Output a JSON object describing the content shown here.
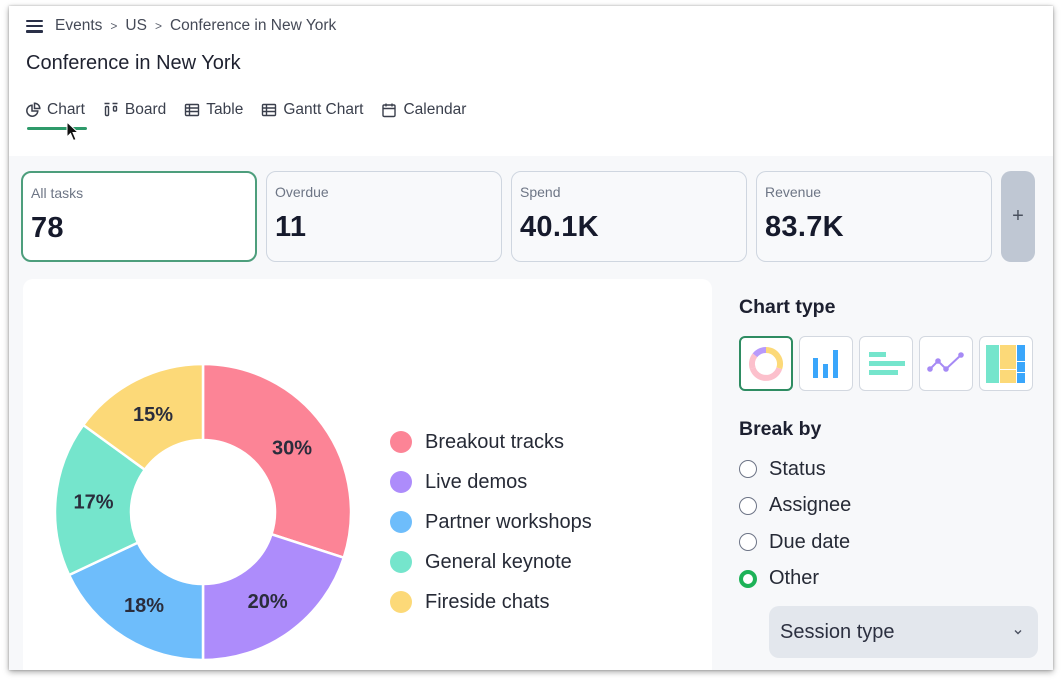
{
  "breadcrumb": {
    "items": [
      "Events",
      "US",
      "Conference in New York"
    ],
    "separator": ">"
  },
  "page": {
    "title": "Conference in New York"
  },
  "tabs": [
    {
      "label": "Chart",
      "icon": "chart-pie-icon",
      "active": true
    },
    {
      "label": "Board",
      "icon": "board-icon",
      "active": false
    },
    {
      "label": "Table",
      "icon": "table-icon",
      "active": false
    },
    {
      "label": "Gantt Chart",
      "icon": "gantt-icon",
      "active": false
    },
    {
      "label": "Calendar",
      "icon": "calendar-icon",
      "active": false
    }
  ],
  "metrics": [
    {
      "label": "All tasks",
      "value": "78",
      "active": true
    },
    {
      "label": "Overdue",
      "value": "11",
      "active": false
    },
    {
      "label": "Spend",
      "value": "40.1K",
      "active": false
    },
    {
      "label": "Revenue",
      "value": "83.7K",
      "active": false
    }
  ],
  "add_metric_label": "+",
  "side_panel": {
    "chart_type_title": "Chart type",
    "chart_types": [
      {
        "name": "donut",
        "icon": "donut-chart-icon",
        "active": true
      },
      {
        "name": "column",
        "icon": "column-chart-icon",
        "active": false
      },
      {
        "name": "bar",
        "icon": "bar-chart-icon",
        "active": false
      },
      {
        "name": "line",
        "icon": "line-chart-icon",
        "active": false
      },
      {
        "name": "treemap",
        "icon": "treemap-icon",
        "active": false
      }
    ],
    "break_by_title": "Break by",
    "break_by_options": [
      {
        "label": "Status",
        "checked": false
      },
      {
        "label": "Assignee",
        "checked": false
      },
      {
        "label": "Due date",
        "checked": false
      },
      {
        "label": "Other",
        "checked": true
      }
    ],
    "other_select_value": "Session type"
  },
  "colors": {
    "accent": "#2e9a6a",
    "radio_checked": "#1db257"
  },
  "chart_data": {
    "type": "pie",
    "variant": "donut",
    "categories": [
      "Breakout tracks",
      "Live demos",
      "Partner workshops",
      "General keynote",
      "Fireside chats"
    ],
    "values": [
      30,
      20,
      18,
      17,
      15
    ],
    "labels": [
      "30%",
      "20%",
      "18%",
      "17%",
      "15%"
    ],
    "colors": [
      "#fc8496",
      "#ad8cfb",
      "#6ebdfb",
      "#75e5cc",
      "#fcd978"
    ],
    "start_angle": "top",
    "direction": "clockwise",
    "legend": "right",
    "title": ""
  }
}
